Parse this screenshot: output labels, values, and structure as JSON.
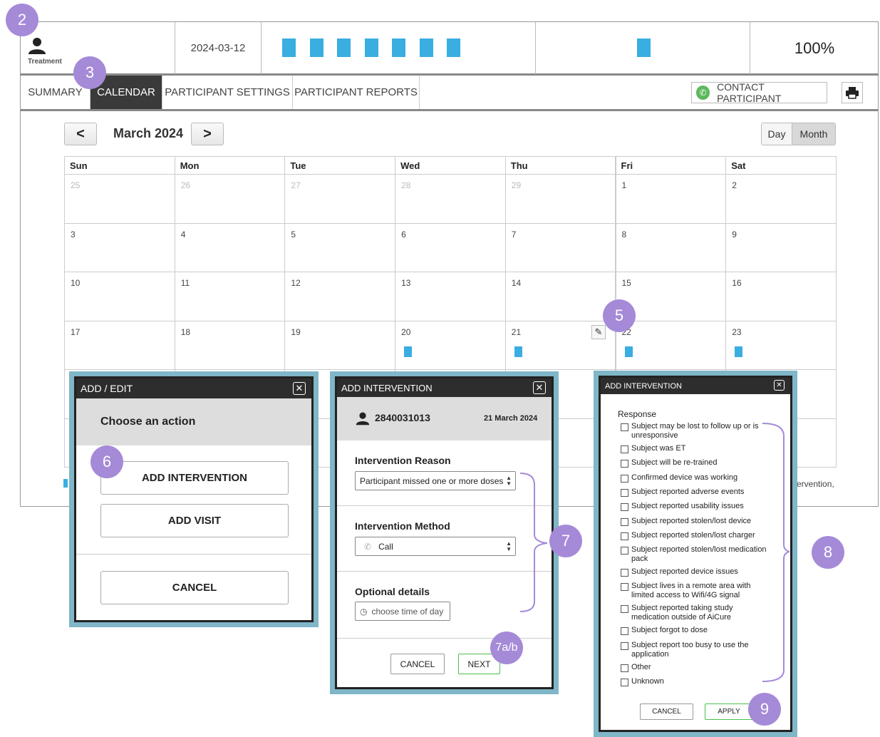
{
  "header": {
    "role_label": "Treatment",
    "date": "2024-03-12",
    "adherence": "100%",
    "colors": {
      "accent": "#3aaee0",
      "badge": "#a58ad8",
      "dark": "#3a3a3a"
    }
  },
  "nav": {
    "tabs": [
      "SUMMARY",
      "CALENDAR",
      "PARTICIPANT SETTINGS",
      "PARTICIPANT REPORTS"
    ],
    "active_tab": "CALENDAR",
    "contact_label": "CONTACT PARTICIPANT",
    "print_icon": "printer-icon"
  },
  "calendar": {
    "month_label": "March 2024",
    "prev_label": "<",
    "next_label": ">",
    "view_day": "Day",
    "view_month": "Month",
    "weekdays": [
      "Sun",
      "Mon",
      "Tue",
      "Wed",
      "Thu",
      "Fri",
      "Sat"
    ],
    "weeks": [
      [
        "25",
        "26",
        "27",
        "28",
        "29",
        "1",
        "2"
      ],
      [
        "3",
        "4",
        "5",
        "6",
        "7",
        "8",
        "9"
      ],
      [
        "10",
        "11",
        "12",
        "13",
        "14",
        "15",
        "16"
      ],
      [
        "17",
        "18",
        "19",
        "20",
        "21",
        "22",
        "23"
      ]
    ],
    "partial_text": "ervention,"
  },
  "badges": [
    "2",
    "3",
    "5",
    "6",
    "7",
    "7a/b",
    "8",
    "9"
  ],
  "add_edit": {
    "title": "ADD / EDIT",
    "heading": "Choose an action",
    "add_intervention": "ADD INTERVENTION",
    "add_visit": "ADD VISIT",
    "cancel": "CANCEL"
  },
  "intervention": {
    "title": "ADD INTERVENTION",
    "participant_id": "2840031013",
    "date": "21 March 2024",
    "reason_label": "Intervention Reason",
    "reason_value": "Participant missed one or more doses",
    "method_label": "Intervention Method",
    "method_value": "Call",
    "optional_label": "Optional details",
    "time_placeholder": "choose time of day",
    "cancel": "CANCEL",
    "next": "NEXT"
  },
  "response": {
    "title": "ADD INTERVENTION",
    "label": "Response",
    "options": [
      "Subject may be lost to follow up or is unresponsive",
      "Subject was ET",
      "Subject will be re-trained",
      "Confirmed device was working",
      "Subject reported adverse events",
      "Subject reported usability issues",
      "Subject reported stolen/lost device",
      "Subject reported stolen/lost charger",
      "Subject reported stolen/lost medication pack",
      "Subject reported device issues",
      "Subject lives in a remote area with limited access to Wifi/4G signal",
      "Subject reported taking study medication outside of AiCure",
      "Subject forgot to dose",
      "Subject report too busy to use the application",
      "Other",
      "Unknown"
    ],
    "cancel": "CANCEL",
    "apply": "APPLY"
  }
}
